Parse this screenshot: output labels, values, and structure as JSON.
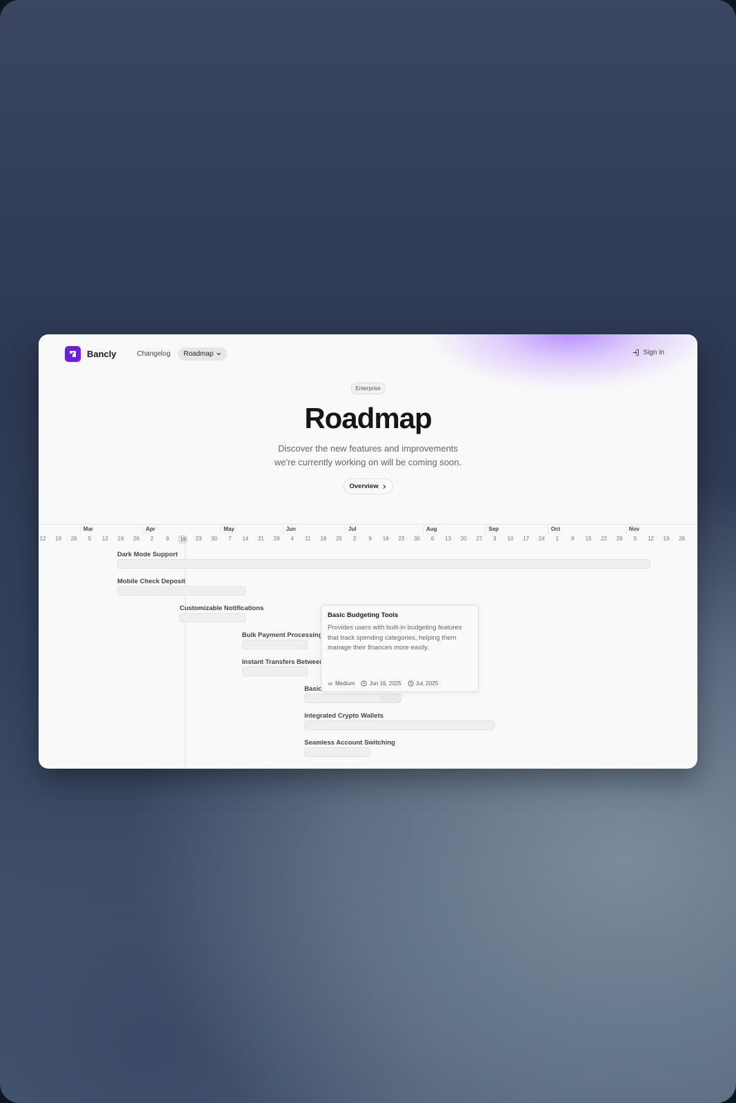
{
  "nav": {
    "brand": "Bancly",
    "links": [
      "Changelog"
    ],
    "active": "Roadmap",
    "signin": "Sign in"
  },
  "hero": {
    "badge": "Enterprise",
    "title": "Roadmap",
    "subtitle_line1": "Discover the new features and improvements",
    "subtitle_line2": "we're currently working on will be coming soon.",
    "cta": "Overview"
  },
  "timeline": {
    "months": [
      "Mar",
      "Apr",
      "May",
      "Jun",
      "Jul",
      "Aug",
      "Sep",
      "Oct",
      "Nov"
    ],
    "days": [
      "12",
      "19",
      "26",
      "5",
      "12",
      "19",
      "26",
      "2",
      "9",
      "16",
      "23",
      "30",
      "7",
      "14",
      "21",
      "28",
      "4",
      "11",
      "18",
      "25",
      "2",
      "9",
      "16",
      "23",
      "30",
      "6",
      "13",
      "20",
      "27",
      "3",
      "10",
      "17",
      "24",
      "1",
      "8",
      "15",
      "22",
      "29",
      "5",
      "12",
      "19",
      "26"
    ],
    "today": "16",
    "features": [
      {
        "name": "Dark Mode Support",
        "start": "Mar 19",
        "end": "Nov 12"
      },
      {
        "name": "Mobile Check Deposit",
        "start": "Mar 19",
        "end": "May 14"
      },
      {
        "name": "Customizable Notifications",
        "start": "Apr 16",
        "end": "May 14"
      },
      {
        "name": "Bulk Payment Processing",
        "start": "May 14",
        "end": "Jun 11"
      },
      {
        "name": "Instant Transfers Between Accounts",
        "start": "May 14",
        "end": "Jun 11"
      },
      {
        "name": "Basic Budgeting Tools",
        "start": "Jun 11",
        "end": "Jul 23"
      },
      {
        "name": "Integrated Crypto Wallets",
        "start": "Jun 11",
        "end": "Sep 3"
      },
      {
        "name": "Seamless Account Switching",
        "start": "Jun 11",
        "end": "Jul 9"
      }
    ]
  },
  "tooltip": {
    "title": "Basic Budgeting Tools",
    "description": "Provides users with built-in budgeting features that track spending categories, helping them manage their finances more easily.",
    "priority": "Medium",
    "start": "Jun 16, 2025",
    "end": "Jul, 2025"
  },
  "colors": {
    "brand": "#6b21d8",
    "glow": "#a778ff"
  }
}
